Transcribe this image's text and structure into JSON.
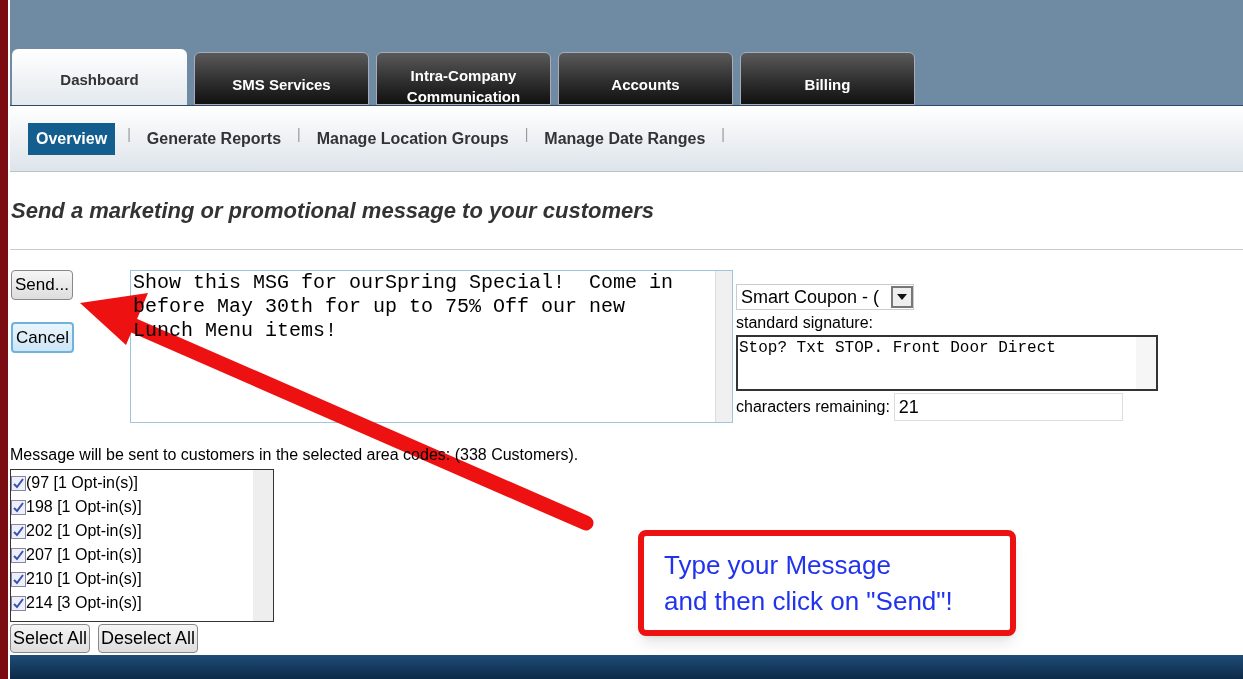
{
  "tabs": [
    {
      "label": "Dashboard",
      "selected": true
    },
    {
      "label": "SMS Services",
      "selected": false
    },
    {
      "label": "Intra-Company Communication",
      "selected": false
    },
    {
      "label": "Accounts",
      "selected": false
    },
    {
      "label": "Billing",
      "selected": false
    }
  ],
  "subnav": [
    {
      "label": "Overview",
      "selected": true
    },
    {
      "label": "Generate Reports",
      "selected": false
    },
    {
      "label": "Manage Location Groups",
      "selected": false
    },
    {
      "label": "Manage Date Ranges",
      "selected": false
    }
  ],
  "separator": "|",
  "heading": "Send a marketing or promotional message to your customers",
  "send_button": "Send...",
  "cancel_button": "Cancel",
  "message": "Show this MSG for ourSpring Special!  Come in before May 30th for up to 75% Off our new Lunch Menu items!",
  "template_select": "Smart Coupon - (",
  "signature_label": "standard signature:",
  "signature": "Stop? Txt STOP. Front Door Direct",
  "remaining_label": "characters remaining:",
  "remaining": "21",
  "recipients_text": "Message will be sent to customers in the selected area codes: (338 Customers).",
  "area_codes": [
    {
      "label": "(97 [1 Opt-in(s)]",
      "checked": true
    },
    {
      "label": "198 [1 Opt-in(s)]",
      "checked": true
    },
    {
      "label": "202 [1 Opt-in(s)]",
      "checked": true
    },
    {
      "label": "207 [1 Opt-in(s)]",
      "checked": true
    },
    {
      "label": "210 [1 Opt-in(s)]",
      "checked": true
    },
    {
      "label": "214 [3 Opt-in(s)]",
      "checked": true
    }
  ],
  "select_all": "Select All",
  "deselect_all": "Deselect All",
  "callout": {
    "line_1": "Type your Message",
    "line_2": "and then click on \"Send\"!"
  }
}
